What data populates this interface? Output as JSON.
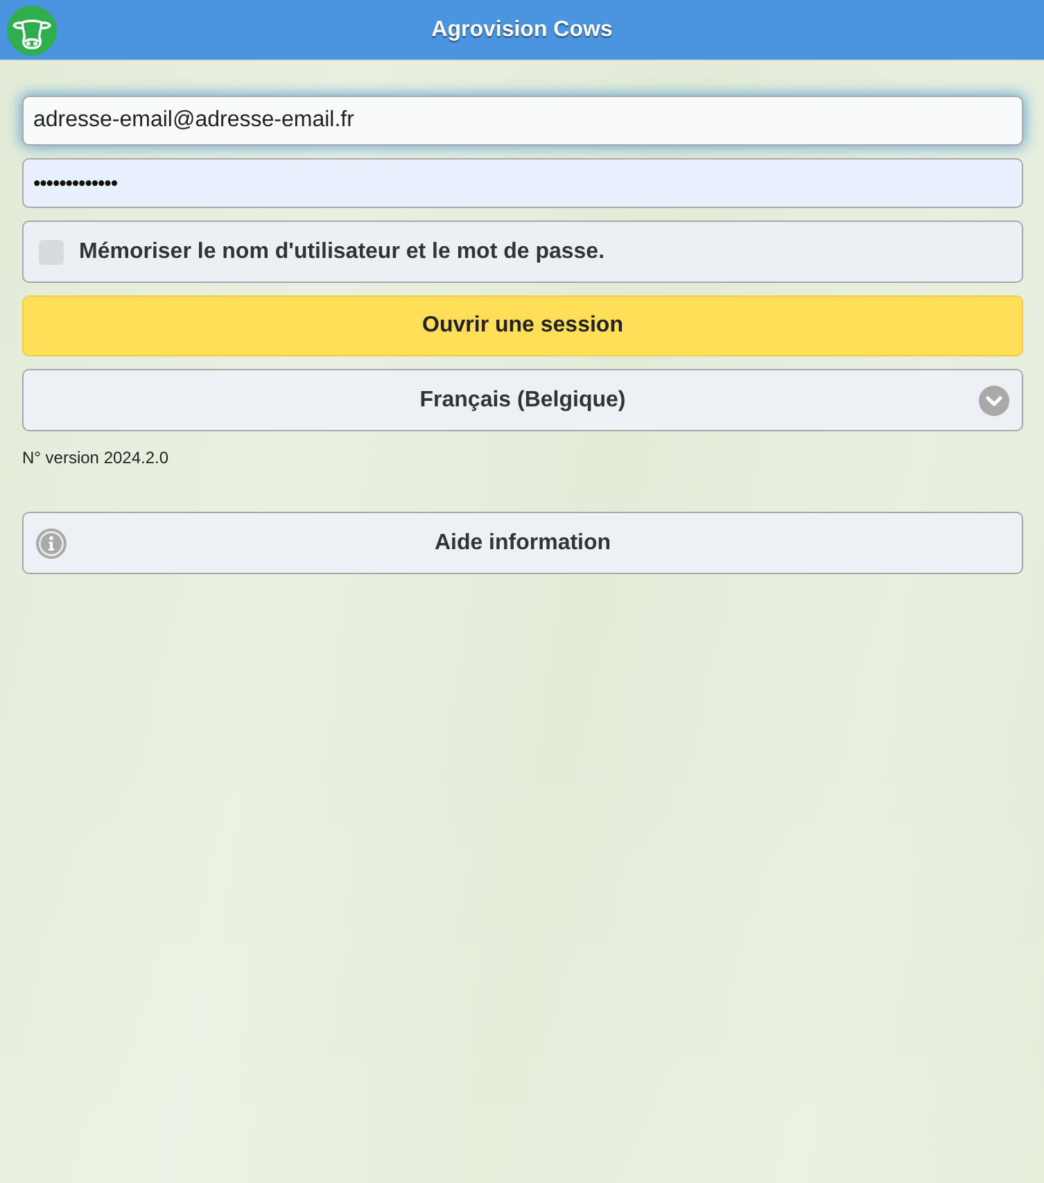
{
  "header": {
    "title": "Agrovision Cows"
  },
  "login_form": {
    "fields": [
      {
        "kind": "email",
        "value": "adresse-email@adresse-email.fr",
        "focused": true,
        "autofilled": false
      },
      {
        "kind": "password",
        "value": "•••••••••••••",
        "focused": false,
        "autofilled": true
      }
    ],
    "remember": {
      "label": "Mémoriser le nom d'utilisateur et le mot de passe.",
      "checked": false
    },
    "submit_button": {
      "label": "Ouvrir une session"
    },
    "language_select": {
      "value": "Français (Belgique)"
    }
  },
  "version": "N° version 2024.2.0",
  "help_button": {
    "label": "Aide information"
  }
}
